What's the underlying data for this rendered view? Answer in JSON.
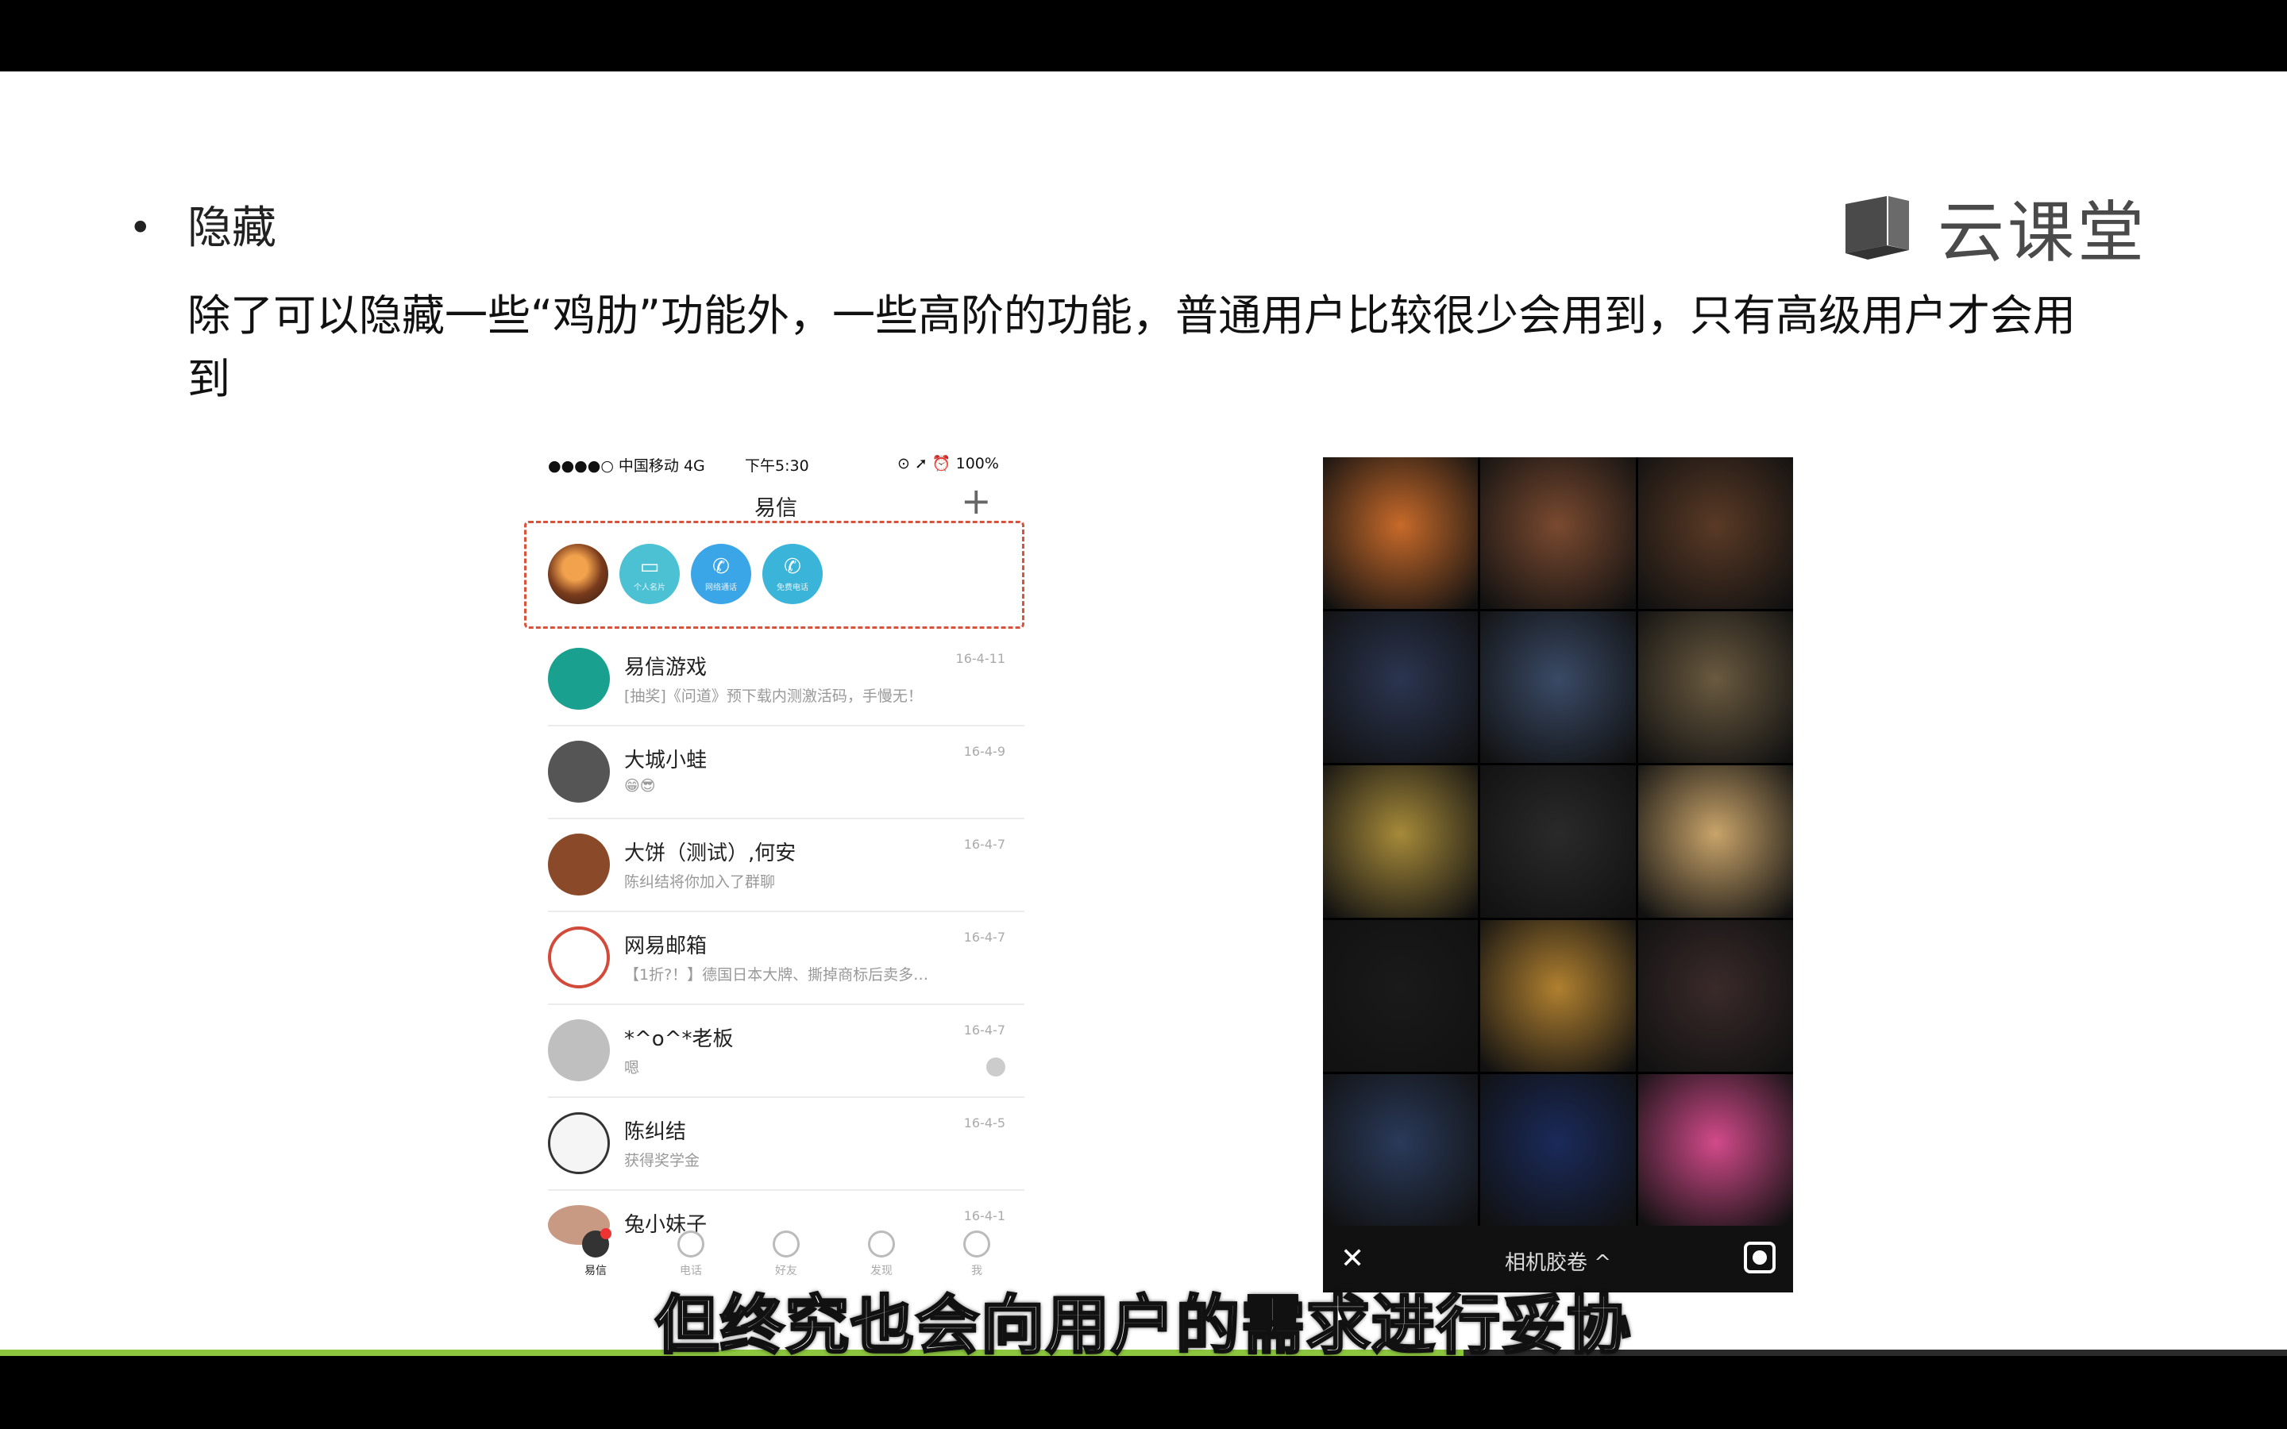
{
  "slide": {
    "bullet": "•",
    "heading": "隐藏",
    "description": "除了可以隐藏一些“鸡肋”功能外，一些高阶的功能，普通用户比较很少会用到，只有高级用户才会用到"
  },
  "logo": {
    "text": "云课堂",
    "icon": "book-icon"
  },
  "phone": {
    "status": {
      "carrier": "●●●●○ 中国移动  4G",
      "time": "下午5:30",
      "battery": "⊙ ➚ ⏰ 100%"
    },
    "nav_title": "易信",
    "plus": "+",
    "quick_actions": [
      {
        "label": "个人名片",
        "icon": "card-icon",
        "glyph": "▭"
      },
      {
        "label": "网络通话",
        "icon": "wifi-call-icon",
        "glyph": "✆"
      },
      {
        "label": "免费电话",
        "icon": "phone-icon",
        "glyph": "✆"
      }
    ],
    "conversations": [
      {
        "name": "易信游戏",
        "msg": "[抽奖]《问道》预下载内测激活码，手慢无！",
        "time": "16-4-11",
        "avatar_color": "#1aa08e"
      },
      {
        "name": "大城小蛙",
        "msg": "😁😎",
        "time": "16-4-9",
        "avatar_color": "#555"
      },
      {
        "name": "大饼（测试）,何安",
        "msg": "陈纠结将你加入了群聊",
        "time": "16-4-7",
        "avatar_color": "#8a4a2a"
      },
      {
        "name": "网易邮箱",
        "msg": "【1折?！】德国日本大牌、撕掉商标后卖多…",
        "time": "16-4-7",
        "avatar_color": "#d24a3a"
      },
      {
        "name": "*^o^*老板",
        "msg": "嗯",
        "time": "16-4-7",
        "avatar_color": "#bfbfbf"
      },
      {
        "name": "陈纠结",
        "msg": "获得奖学金",
        "time": "16-4-5",
        "avatar_color": "#f5f5f5"
      },
      {
        "name": "兔小妹子",
        "msg": "",
        "time": "16-4-1",
        "avatar_color": "#c89a84"
      }
    ],
    "tabs": [
      {
        "label": "易信",
        "active": true
      },
      {
        "label": "电话",
        "active": false
      },
      {
        "label": "好友",
        "active": false
      },
      {
        "label": "发现",
        "active": false
      },
      {
        "label": "我",
        "active": false
      }
    ]
  },
  "gallery": {
    "title": "相机胶卷 ^",
    "close": "✕",
    "cells": [
      "#c76a2a",
      "#7a4a30",
      "#5a3a26",
      "#2b3550",
      "#3a4a66",
      "#6a5a40",
      "#a68a3a",
      "#2a2a2a",
      "#c9a46a",
      "#1a1a1a",
      "#b08030",
      "#3a2a2a",
      "#2a3a5a",
      "#1a2a5a",
      "#d24a8a"
    ]
  },
  "subtitle": "但终究也会向用户的需求进行妥协",
  "progress": 0.64
}
